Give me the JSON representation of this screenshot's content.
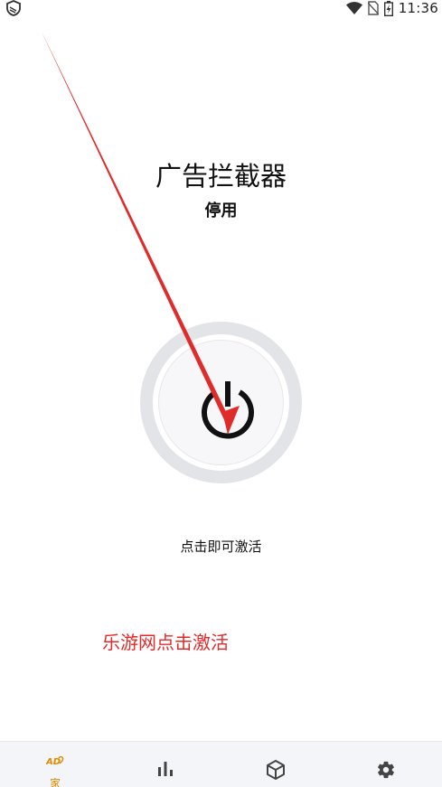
{
  "status_bar": {
    "time": "11:36"
  },
  "main": {
    "title": "广告拦截器",
    "state": "停用",
    "hint": "点击即可激活"
  },
  "overlay": {
    "watermark": "乐游网点击激活",
    "arrow_color": "#e02b2b"
  },
  "bottom_nav": {
    "items": [
      {
        "label": "家",
        "icon": "ad-block-logo-icon",
        "active": true
      },
      {
        "label": "",
        "icon": "bar-chart-icon"
      },
      {
        "label": "",
        "icon": "package-icon"
      },
      {
        "label": "",
        "icon": "gear-icon"
      }
    ],
    "home_logo_text": "AD"
  },
  "colors": {
    "accent": "#e08a00",
    "text": "#111111",
    "ring": "#e3e4e8",
    "nav_bg": "#f4f5f8"
  }
}
